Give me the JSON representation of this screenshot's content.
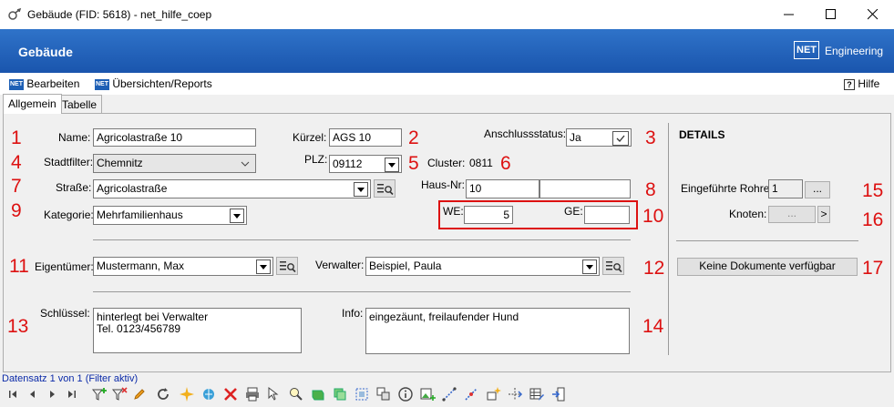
{
  "window": {
    "title": "Gebäude (FID: 5618) - net_hilfe_coep"
  },
  "header": {
    "title": "Gebäude",
    "logo_net": "NET",
    "logo_text": "Engineering"
  },
  "menu": {
    "edit": "Bearbeiten",
    "reports": "Übersichten/Reports",
    "help_key": "?",
    "help": "Hilfe"
  },
  "tabs": [
    "Allgemein",
    "Tabelle"
  ],
  "form": {
    "name_label": "Name:",
    "name_value": "Agricolastraße 10",
    "kuerzel_label": "Kürzel:",
    "kuerzel_value": "AGS 10",
    "anschluss_label": "Anschlussstatus:",
    "anschluss_value": "Ja",
    "stadtfilter_label": "Stadtfilter:",
    "stadtfilter_value": "Chemnitz",
    "plz_label": "PLZ:",
    "plz_value": "09112",
    "cluster_label": "Cluster:",
    "cluster_value": "0811",
    "strasse_label": "Straße:",
    "strasse_value": "Agricolastraße",
    "hausnr_label": "Haus-Nr:",
    "hausnr_value": "10",
    "hausnr_suffix": "",
    "kategorie_label": "Kategorie:",
    "kategorie_value": "Mehrfamilienhaus",
    "we_label": "WE:",
    "we_value": "5",
    "ge_label": "GE:",
    "ge_value": "",
    "eigentuemer_label": "Eigentümer:",
    "eigentuemer_value": "Mustermann, Max",
    "verwalter_label": "Verwalter:",
    "verwalter_value": "Beispiel, Paula",
    "schluessel_label": "Schlüssel:",
    "schluessel_line1": "hinterlegt bei Verwalter",
    "schluessel_line2": "Tel. 0123/456789",
    "info_label": "Info:",
    "info_value": "eingezäunt, freilaufender Hund"
  },
  "details": {
    "title": "DETAILS",
    "rohre_label": "Eingeführte Rohre:",
    "rohre_value": "1",
    "rohre_btn": "...",
    "knoten_label": "Knoten:",
    "knoten_btn": "...",
    "knoten_next": ">",
    "docs_btn": "Keine Dokumente verfügbar"
  },
  "numbers": [
    "1",
    "2",
    "3",
    "4",
    "5",
    "6",
    "7",
    "8",
    "9",
    "10",
    "11",
    "12",
    "13",
    "14",
    "15",
    "16",
    "17"
  ],
  "status": {
    "record": "Datensatz 1 von 1 (Filter aktiv)"
  },
  "colors": {
    "header": "#1a55ad",
    "annotation": "#d11111",
    "status_text": "#0b2aa8"
  }
}
